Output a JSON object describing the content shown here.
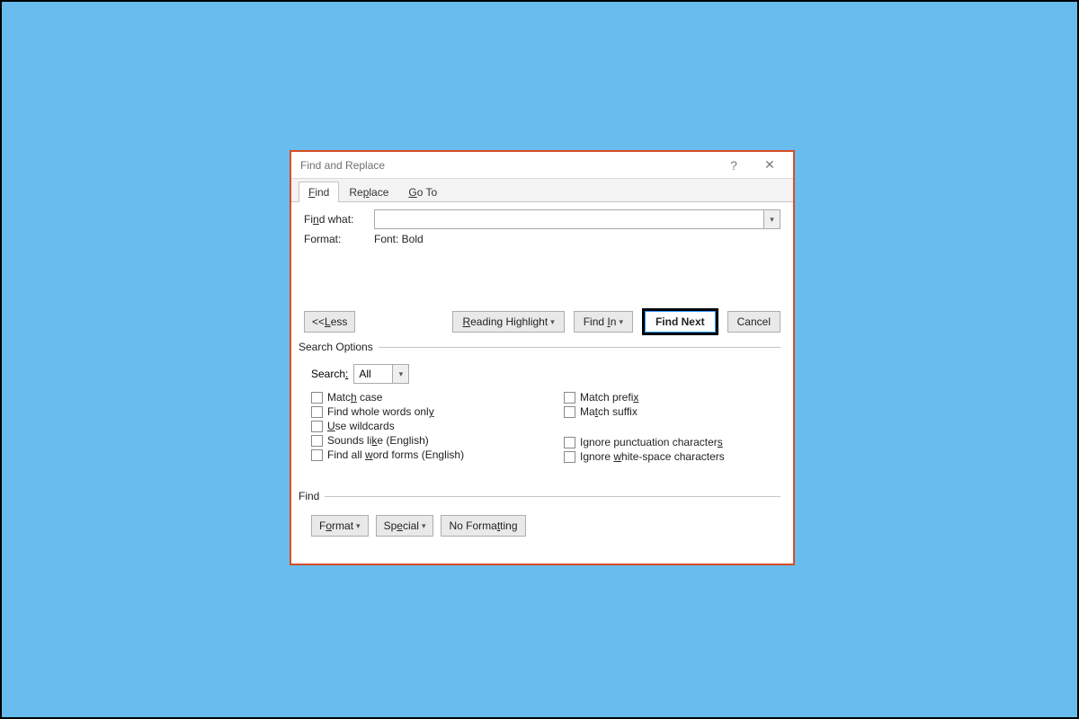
{
  "dialog": {
    "title": "Find and Replace",
    "help_icon": "?",
    "close_icon": "✕"
  },
  "tabs": {
    "find": "Find",
    "replace": "Replace",
    "goto": "Go To"
  },
  "find_section": {
    "find_what_label": "Find what:",
    "find_what_value": "",
    "format_label": "Format:",
    "format_value": "Font: Bold"
  },
  "buttons": {
    "less": "<< Less",
    "reading_highlight": "Reading Highlight",
    "find_in": "Find In",
    "find_next": "Find Next",
    "cancel": "Cancel"
  },
  "search_options": {
    "legend": "Search Options",
    "search_label": "Search:",
    "search_value": "All",
    "left": {
      "match_case": "Match case",
      "whole_words": "Find whole words only",
      "wildcards": "Use wildcards",
      "sounds_like": "Sounds like (English)",
      "word_forms": "Find all word forms (English)"
    },
    "right": {
      "match_prefix": "Match prefix",
      "match_suffix": "Match suffix",
      "ignore_punct": "Ignore punctuation characters",
      "ignore_ws": "Ignore white-space characters"
    }
  },
  "find_footer": {
    "legend": "Find",
    "format": "Format",
    "special": "Special",
    "no_formatting": "No Formatting"
  }
}
